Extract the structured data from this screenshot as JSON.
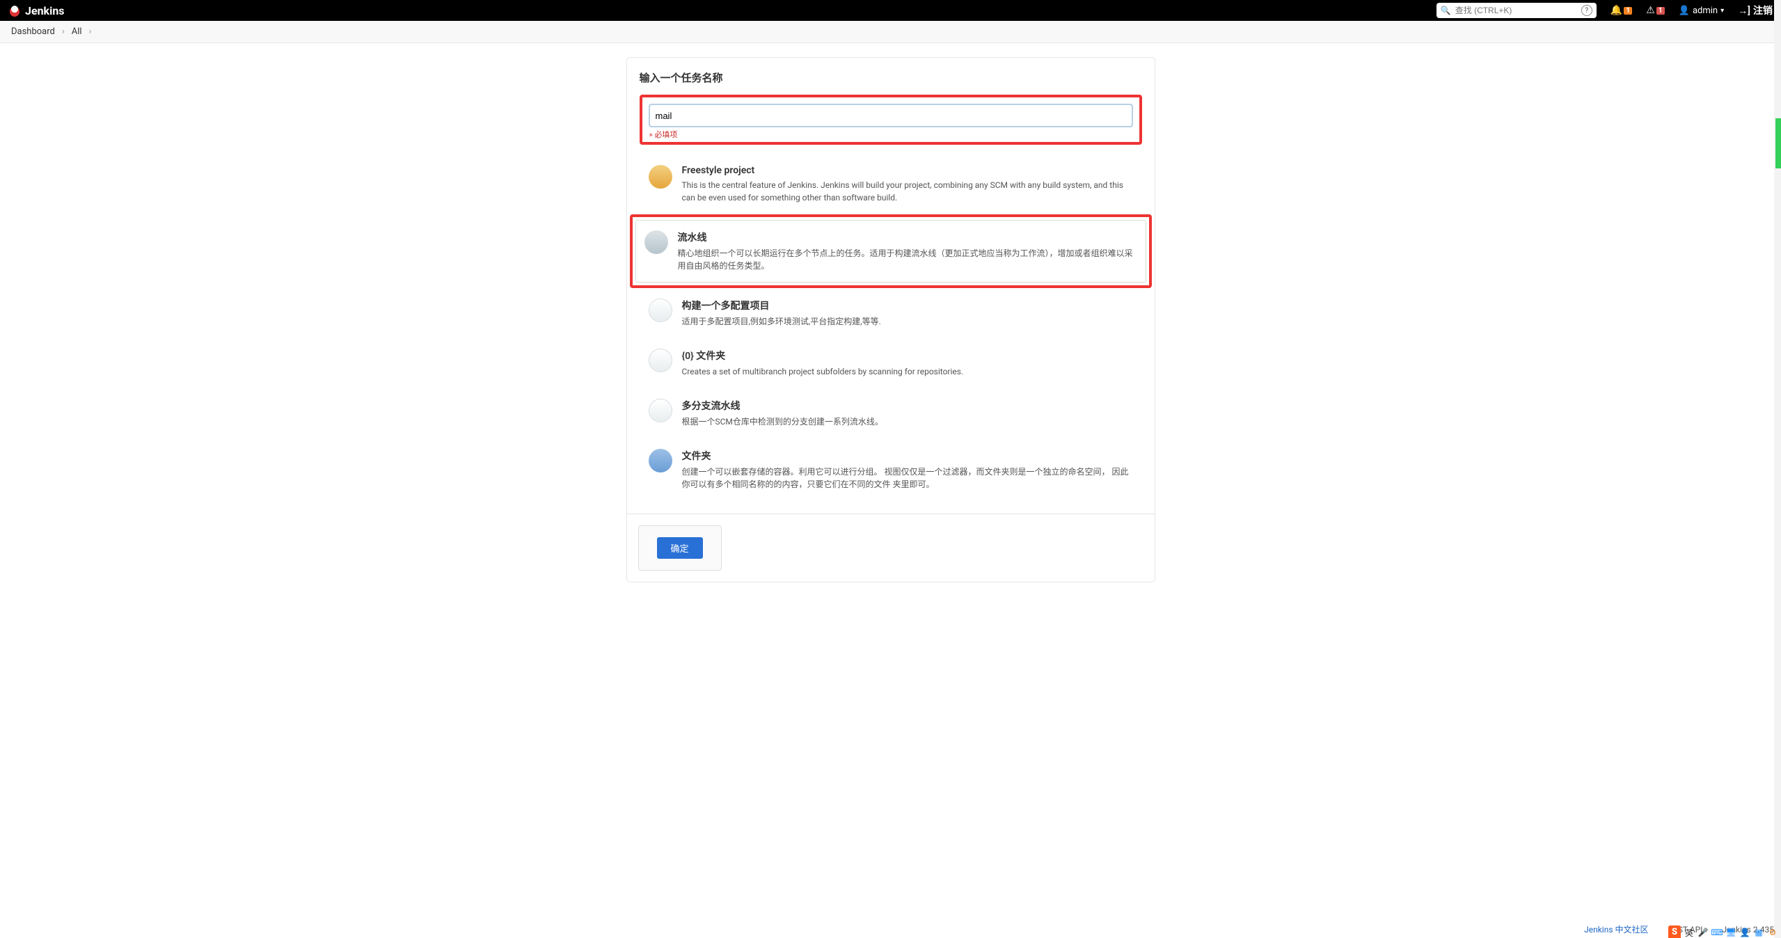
{
  "header": {
    "brand": "Jenkins",
    "search_placeholder": "查找 (CTRL+K)",
    "notif_count": "1",
    "alert_count": "1",
    "user": "admin",
    "logout": "注销"
  },
  "breadcrumb": {
    "items": [
      "Dashboard",
      "All"
    ]
  },
  "page": {
    "heading": "输入一个任务名称",
    "name_value": "mail",
    "required_note": "» 必填项",
    "ok_label": "确定"
  },
  "types": [
    {
      "id": "freestyle",
      "title": "Freestyle project",
      "desc": "This is the central feature of Jenkins. Jenkins will build your project, combining any SCM with any build system, and this can be even used for something other than software build.",
      "highlighted": false,
      "icon": "ic-freestyle"
    },
    {
      "id": "pipeline",
      "title": "流水线",
      "desc": "精心地组织一个可以长期运行在多个节点上的任务。适用于构建流水线（更加正式地应当称为工作流），增加或者组织难以采用自由风格的任务类型。",
      "highlighted": true,
      "icon": "ic-pipeline"
    },
    {
      "id": "multiconfig",
      "title": "构建一个多配置项目",
      "desc": "适用于多配置项目,例如多环境测试,平台指定构建,等等.",
      "highlighted": false,
      "icon": "ic-multiconfig"
    },
    {
      "id": "orgfolder",
      "title": "{0} 文件夹",
      "desc": "Creates a set of multibranch project subfolders by scanning for repositories.",
      "highlighted": false,
      "icon": "ic-orgfolder"
    },
    {
      "id": "multibranch",
      "title": "多分支流水线",
      "desc": "根据一个SCM仓库中检测到的分支创建一系列流水线。",
      "highlighted": false,
      "icon": "ic-multibranch"
    },
    {
      "id": "folder",
      "title": "文件夹",
      "desc": "创建一个可以嵌套存储的容器。利用它可以进行分组。 视图仅仅是一个过滤器，而文件夹则是一个独立的命名空间， 因此你可以有多个相同名称的的内容，只要它们在不同的文件 夹里即可。",
      "highlighted": false,
      "icon": "ic-folder"
    }
  ],
  "footer": {
    "community": "Jenkins 中文社区",
    "rest_api": "REST API",
    "version": "Jenkins 2.435"
  },
  "ime": {
    "badge": "S",
    "lang": "英"
  }
}
